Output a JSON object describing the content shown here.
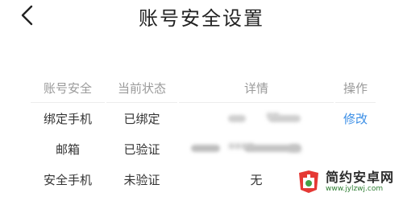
{
  "header": {
    "title": "账号安全设置",
    "back_icon": "chevron-left-icon"
  },
  "table": {
    "columns": [
      "账号安全",
      "当前状态",
      "详情",
      "操作"
    ],
    "rows": [
      {
        "item": "绑定手机",
        "status": "已绑定",
        "detail": "",
        "detail_masked": true,
        "action": "修改"
      },
      {
        "item": "邮箱",
        "status": "已验证",
        "detail": "",
        "detail_masked": true,
        "action": ""
      },
      {
        "item": "安全手机",
        "status": "未验证",
        "detail": "无",
        "detail_masked": false,
        "action": ""
      }
    ]
  },
  "watermark": {
    "name": "简约安卓网",
    "url": "www.jylzwj.com"
  },
  "colors": {
    "link": "#3a8ee6",
    "header_text": "#9a9a9a",
    "logo_red": "#e53935",
    "logo_green": "#43a047"
  }
}
